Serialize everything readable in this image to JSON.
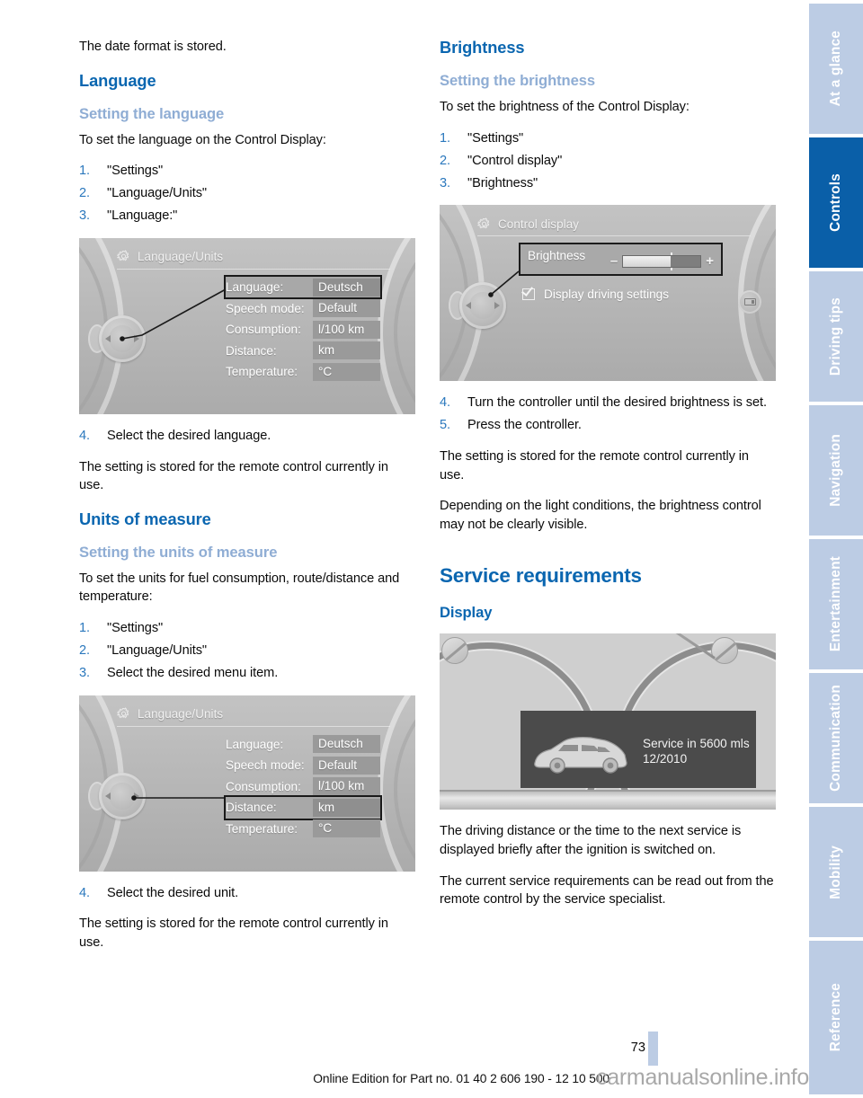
{
  "page": {
    "number": "73",
    "edition": "Online Edition for Part no. 01 40 2 606 190 - 12 10 500",
    "watermark": "carmanualsonline.info"
  },
  "colors": {
    "heading_blue": "#0a66b0",
    "subheading_light_blue": "#8fadd4",
    "tab_inactive": "#bccce4",
    "tab_active": "#0a5fa8",
    "step_number": "#2b78bd"
  },
  "left_column": {
    "intro_text": "The date format is stored.",
    "language_section": {
      "title": "Language",
      "subtitle": "Setting the language",
      "lead": "To set the language on the Control Display:",
      "steps": [
        {
          "num": "1.",
          "text": "\"Settings\""
        },
        {
          "num": "2.",
          "text": "\"Language/Units\""
        },
        {
          "num": "3.",
          "text": "\"Language:\""
        }
      ],
      "step4": {
        "num": "4.",
        "text": "Select the desired language."
      },
      "closing": "The setting is stored for the remote control currently in use."
    },
    "units_section": {
      "title": "Units of measure",
      "subtitle": "Setting the units of measure",
      "lead": "To set the units for fuel consumption, route/distance and temperature:",
      "steps": [
        {
          "num": "1.",
          "text": "\"Settings\""
        },
        {
          "num": "2.",
          "text": "\"Language/Units\""
        },
        {
          "num": "3.",
          "text": "Select the desired menu item."
        }
      ],
      "step4": {
        "num": "4.",
        "text": "Select the desired unit."
      },
      "closing": "The setting is stored for the remote control currently in use."
    },
    "figure_language": {
      "icon": "gear-icon",
      "title": "Language/Units",
      "selected_row": "Language:",
      "rows": [
        {
          "label": "Language:",
          "value": "Deutsch"
        },
        {
          "label": "Speech mode:",
          "value": "Default"
        },
        {
          "label": "Consumption:",
          "value": "l/100 km"
        },
        {
          "label": "Distance:",
          "value": "km"
        },
        {
          "label": "Temperature:",
          "value": "°C"
        }
      ]
    },
    "figure_units": {
      "icon": "gear-icon",
      "title": "Language/Units",
      "selected_row": "Distance:",
      "rows": [
        {
          "label": "Language:",
          "value": "Deutsch"
        },
        {
          "label": "Speech mode:",
          "value": "Default"
        },
        {
          "label": "Consumption:",
          "value": "l/100 km"
        },
        {
          "label": "Distance:",
          "value": "km"
        },
        {
          "label": "Temperature:",
          "value": "°C"
        }
      ]
    }
  },
  "right_column": {
    "brightness_section": {
      "title": "Brightness",
      "subtitle": "Setting the brightness",
      "lead": "To set the brightness of the Control Display:",
      "steps": [
        {
          "num": "1.",
          "text": "\"Settings\""
        },
        {
          "num": "2.",
          "text": "\"Control display\""
        },
        {
          "num": "3.",
          "text": "\"Brightness\""
        }
      ],
      "steps_after": [
        {
          "num": "4.",
          "text": "Turn the controller until the desired brightness is set."
        },
        {
          "num": "5.",
          "text": "Press the controller."
        }
      ],
      "closing": "The setting is stored for the remote control currently in use.",
      "note": "Depending on the light conditions, the brightness control may not be clearly visible."
    },
    "service_section": {
      "title": "Service requirements",
      "subtitle": "Display",
      "paragraph1": "The driving distance or the time to the next service is displayed briefly after the ignition is switched on.",
      "paragraph2": "The current service requirements can be read out from the remote control by the service specialist."
    },
    "figure_brightness": {
      "icon": "gear-icon",
      "title": "Control display",
      "setting_label": "Brightness",
      "minus": "–",
      "plus": "+",
      "slider_percent": 61,
      "checkbox_label": "Display driving settings",
      "checkbox_checked": true
    },
    "figure_service": {
      "service_line1": "Service in 5600 mls",
      "service_line2": "12/2010"
    }
  },
  "sidebar": {
    "tabs": [
      {
        "label": "At a glance",
        "active": false
      },
      {
        "label": "Controls",
        "active": true
      },
      {
        "label": "Driving tips",
        "active": false
      },
      {
        "label": "Navigation",
        "active": false
      },
      {
        "label": "Entertainment",
        "active": false
      },
      {
        "label": "Communication",
        "active": false
      },
      {
        "label": "Mobility",
        "active": false
      },
      {
        "label": "Reference",
        "active": false
      }
    ]
  }
}
